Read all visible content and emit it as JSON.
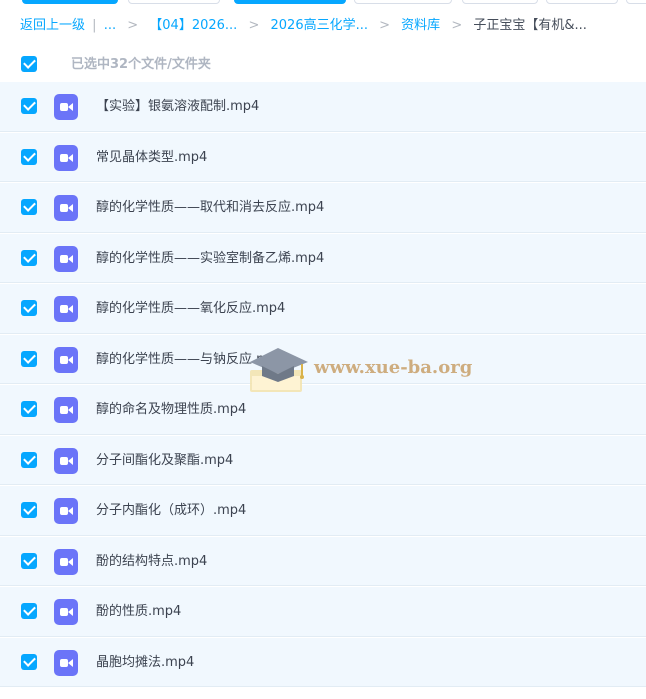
{
  "toolbar": {
    "colors": {
      "primary": "#06a7ff",
      "secondary": "#ffffff"
    }
  },
  "breadcrumb": {
    "back": "返回上一级",
    "divider": "|",
    "ellipsis": "...",
    "sep": ">",
    "items": [
      "【04】2026...",
      "2026高三化学...",
      "资料库"
    ],
    "current": "子正宝宝【有机&..."
  },
  "selection": {
    "text": "已选中32个文件/文件夹"
  },
  "files": [
    {
      "name": "【实验】银氨溶液配制.mp4",
      "icon": "video-icon"
    },
    {
      "name": "常见晶体类型.mp4",
      "icon": "video-icon"
    },
    {
      "name": "醇的化学性质——取代和消去反应.mp4",
      "icon": "video-icon"
    },
    {
      "name": "醇的化学性质——实验室制备乙烯.mp4",
      "icon": "video-icon"
    },
    {
      "name": "醇的化学性质——氧化反应.mp4",
      "icon": "video-icon"
    },
    {
      "name": "醇的化学性质——与钠反应.mp4",
      "icon": "video-icon"
    },
    {
      "name": "醇的命名及物理性质.mp4",
      "icon": "video-icon"
    },
    {
      "name": "分子间酯化及聚酯.mp4",
      "icon": "video-icon"
    },
    {
      "name": "分子内酯化（成环）.mp4",
      "icon": "video-icon"
    },
    {
      "name": "酚的结构特点.mp4",
      "icon": "video-icon"
    },
    {
      "name": "酚的性质.mp4",
      "icon": "video-icon"
    },
    {
      "name": "晶胞均摊法.mp4",
      "icon": "video-icon"
    }
  ],
  "watermark": {
    "text": "www.xue-ba.org"
  }
}
